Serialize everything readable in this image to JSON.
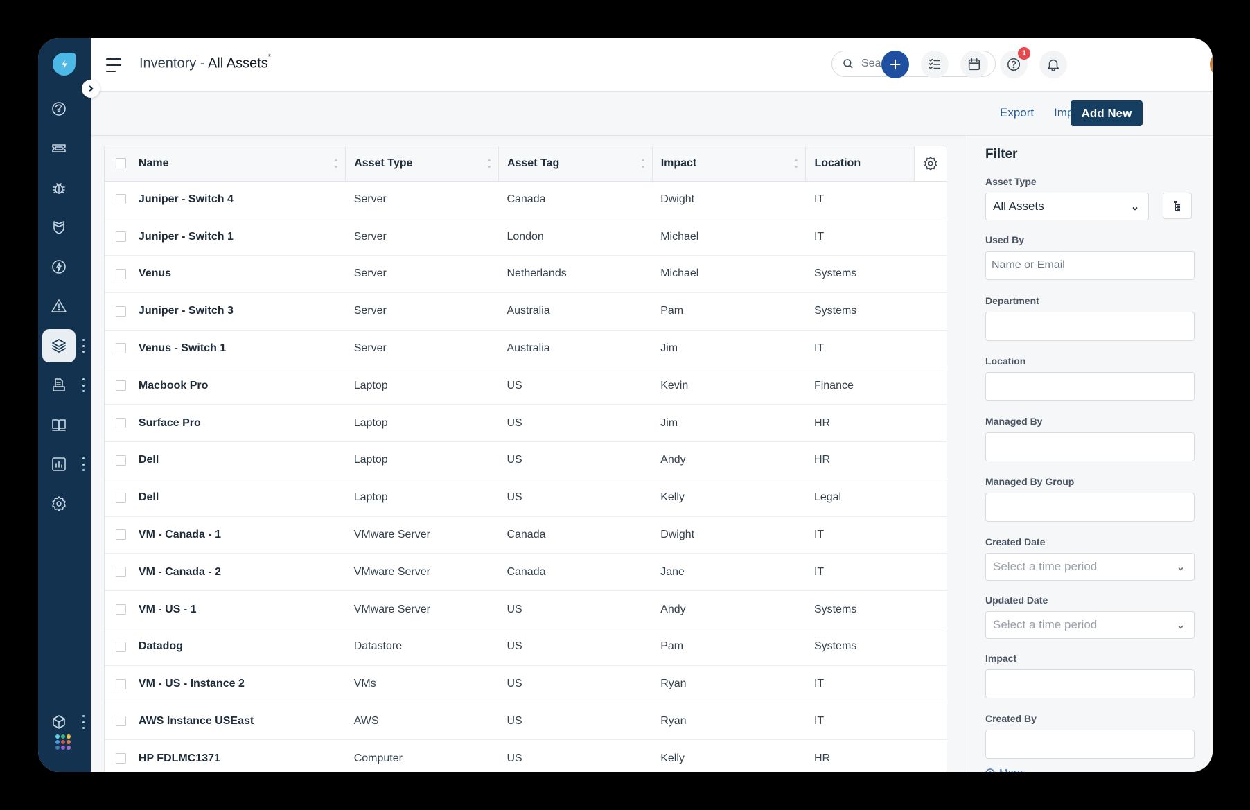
{
  "header": {
    "title_prefix": "Inventory - ",
    "title_main": "All Assets",
    "title_marker": "*",
    "search_placeholder": "Search",
    "help_badge_count": "1"
  },
  "sidebar": {
    "items": [
      {
        "icon": "dashboard-gauge-icon"
      },
      {
        "icon": "ticket-icon"
      },
      {
        "icon": "bug-icon"
      },
      {
        "icon": "shield-icon"
      },
      {
        "icon": "lightning-circle-icon"
      },
      {
        "icon": "warning-triangle-icon"
      },
      {
        "icon": "layers-icon",
        "active": true
      },
      {
        "icon": "document-tray-icon"
      },
      {
        "icon": "book-icon"
      },
      {
        "icon": "bar-chart-icon"
      },
      {
        "icon": "settings-gear-icon"
      }
    ],
    "bottom": [
      {
        "icon": "cube-icon"
      },
      {
        "icon": "apps-grid-icon"
      }
    ],
    "app_dot_colors": [
      "#5fd3e6",
      "#3fb37f",
      "#e8c43a",
      "#4f9bd9",
      "#c65a5a",
      "#d9774a",
      "#4a7bb0",
      "#8f63c9",
      "#a86fd1"
    ]
  },
  "toolbar": {
    "export_label": "Export",
    "import_label": "Import",
    "add_new_label": "Add New"
  },
  "table": {
    "columns": [
      "Name",
      "Asset Type",
      "Asset Tag",
      "Impact",
      "Location"
    ],
    "rows": [
      {
        "name": "Juniper - Switch 4",
        "asset_type": "Server",
        "asset_tag": "Canada",
        "impact": "Dwight",
        "location": "IT"
      },
      {
        "name": "Juniper - Switch 1",
        "asset_type": "Server",
        "asset_tag": "London",
        "impact": "Michael",
        "location": "IT"
      },
      {
        "name": "Venus",
        "asset_type": "Server",
        "asset_tag": "Netherlands",
        "impact": "Michael",
        "location": "Systems"
      },
      {
        "name": "Juniper - Switch 3",
        "asset_type": "Server",
        "asset_tag": "Australia",
        "impact": "Pam",
        "location": "Systems"
      },
      {
        "name": "Venus - Switch 1",
        "asset_type": "Server",
        "asset_tag": "Australia",
        "impact": "Jim",
        "location": "IT"
      },
      {
        "name": "Macbook Pro",
        "asset_type": "Laptop",
        "asset_tag": "US",
        "impact": "Kevin",
        "location": "Finance"
      },
      {
        "name": "Surface Pro",
        "asset_type": "Laptop",
        "asset_tag": "US",
        "impact": "Jim",
        "location": "HR"
      },
      {
        "name": "Dell",
        "asset_type": "Laptop",
        "asset_tag": "US",
        "impact": "Andy",
        "location": "HR"
      },
      {
        "name": "Dell",
        "asset_type": "Laptop",
        "asset_tag": "US",
        "impact": "Kelly",
        "location": "Legal"
      },
      {
        "name": "VM - Canada - 1",
        "asset_type": "VMware Server",
        "asset_tag": "Canada",
        "impact": "Dwight",
        "location": "IT"
      },
      {
        "name": "VM - Canada - 2",
        "asset_type": "VMware Server",
        "asset_tag": "Canada",
        "impact": "Jane",
        "location": "IT"
      },
      {
        "name": "VM - US - 1",
        "asset_type": "VMware Server",
        "asset_tag": "US",
        "impact": "Andy",
        "location": "Systems"
      },
      {
        "name": "Datadog",
        "asset_type": "Datastore",
        "asset_tag": "US",
        "impact": "Pam",
        "location": "Systems"
      },
      {
        "name": "VM - US - Instance 2",
        "asset_type": "VMs",
        "asset_tag": "US",
        "impact": "Ryan",
        "location": "IT"
      },
      {
        "name": "AWS Instance USEast",
        "asset_type": "AWS",
        "asset_tag": "US",
        "impact": "Ryan",
        "location": "IT"
      },
      {
        "name": "HP FDLMC1371",
        "asset_type": "Computer",
        "asset_tag": "US",
        "impact": "Kelly",
        "location": "HR"
      }
    ]
  },
  "filter": {
    "title": "Filter",
    "asset_type_label": "Asset Type",
    "asset_type_value": "All Assets",
    "used_by_label": "Used By",
    "used_by_placeholder": "Name or Email",
    "department_label": "Department",
    "location_label": "Location",
    "managed_by_label": "Managed By",
    "managed_by_group_label": "Managed By Group",
    "created_date_label": "Created Date",
    "created_date_placeholder": "Select a time period",
    "updated_date_label": "Updated Date",
    "updated_date_placeholder": "Select a time period",
    "impact_label": "Impact",
    "created_by_label": "Created By",
    "more_label": "More"
  }
}
